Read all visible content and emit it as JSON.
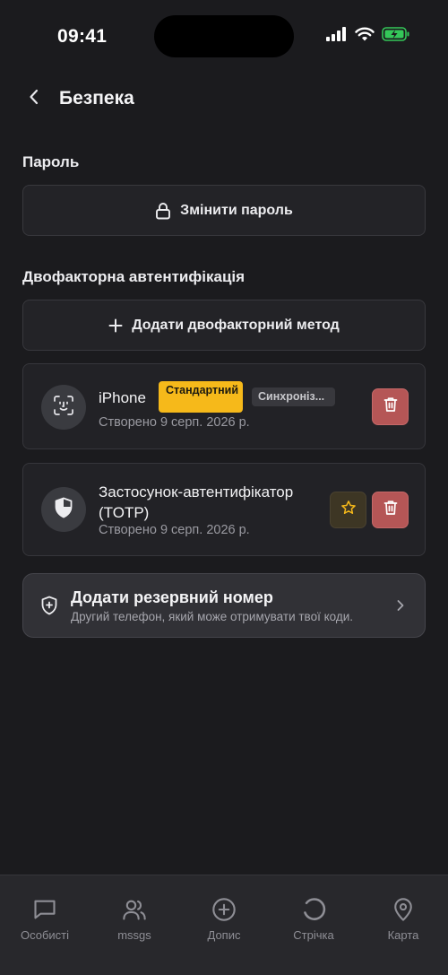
{
  "status_bar": {
    "time": "09:41",
    "icons": [
      "cellular-signal-icon",
      "wifi-icon",
      "battery-charging-icon"
    ]
  },
  "header": {
    "title": "Безпека",
    "back_icon": "chevron-left-icon"
  },
  "password_section": {
    "title": "Пароль",
    "change_button": {
      "label": "Змінити пароль",
      "icon": "lock-icon"
    }
  },
  "twofa_section": {
    "title": "Двофакторна автентифікація",
    "add_button": {
      "label": "Додати двофакторний метод",
      "icon": "plus-icon"
    },
    "methods": [
      {
        "name": "iPhone",
        "icon": "face-id-icon",
        "badge_default": "Стандартний",
        "badge_sync": "Синхроніз...",
        "created": "Створено 9 серп. 2026 р.",
        "delete_icon": "trash-icon"
      },
      {
        "name": "Застосунок-автентифікатор (TOTP)",
        "icon": "shield-icon",
        "created": "Створено 9 серп. 2026 р.",
        "star_icon": "star-icon",
        "delete_icon": "trash-icon"
      }
    ]
  },
  "backup": {
    "title": "Додати резервний номер",
    "subtitle": "Другий телефон, який може отримувати твої коди.",
    "icon": "shield-plus-icon",
    "chevron": "chevron-right-icon"
  },
  "tabbar": {
    "tabs": [
      {
        "label": "Особисті",
        "icon": "message-square-icon"
      },
      {
        "label": "mssgs",
        "icon": "users-icon"
      },
      {
        "label": "Допис",
        "icon": "plus-circle-icon"
      },
      {
        "label": "Стрічка",
        "icon": "circle-icon"
      },
      {
        "label": "Карта",
        "icon": "map-pin-icon"
      }
    ]
  },
  "colors": {
    "background": "#1b1b1e",
    "badge_default": "#f6b91a",
    "delete": "#b55656",
    "star": "#f6b91a"
  }
}
